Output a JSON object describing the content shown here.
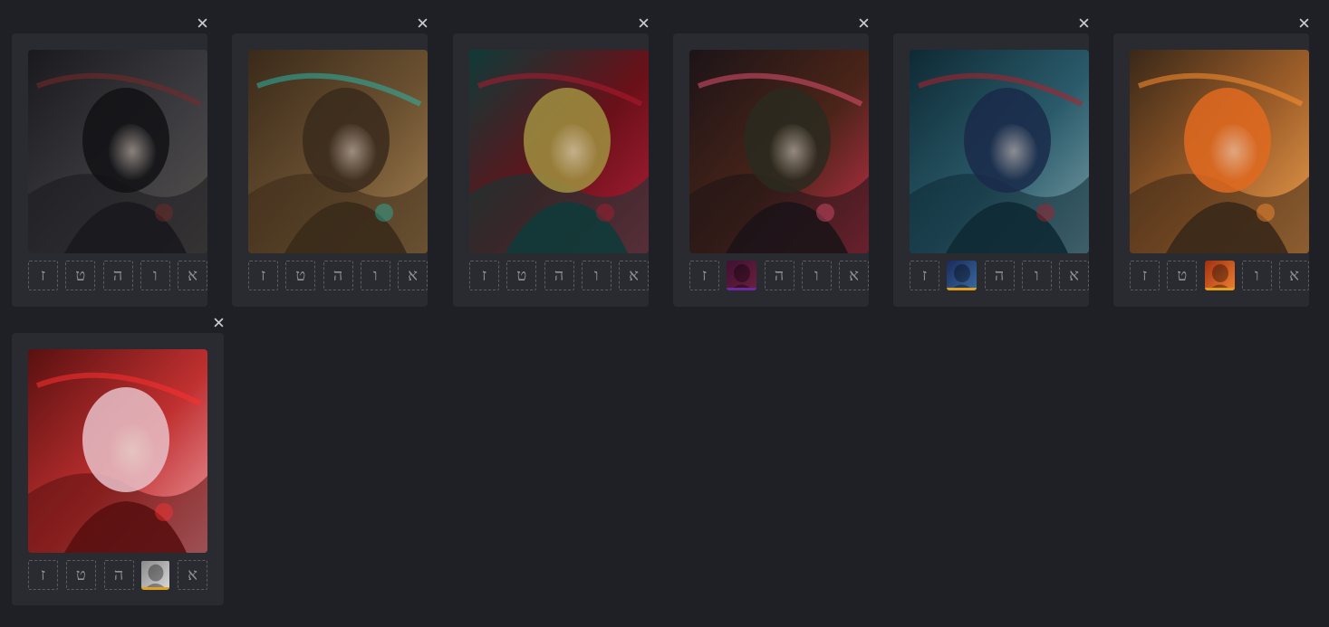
{
  "cards": [
    {
      "id": "card-1",
      "portrait": {
        "bg": [
          "#1a1a1e",
          "#3a3a3f",
          "#58524e"
        ],
        "accent": "#7a2a2a",
        "hair": "#121215"
      },
      "slots": [
        {
          "label": "ז",
          "filled": false
        },
        {
          "label": "ט",
          "filled": false
        },
        {
          "label": "ה",
          "filled": false
        },
        {
          "label": "ו",
          "filled": false
        },
        {
          "label": "א",
          "filled": false
        }
      ]
    },
    {
      "id": "card-2",
      "portrait": {
        "bg": [
          "#3a2a1a",
          "#6a5030",
          "#a48050"
        ],
        "accent": "#2bb3a5",
        "hair": "#3a2a1c"
      },
      "slots": [
        {
          "label": "ז",
          "filled": false
        },
        {
          "label": "ט",
          "filled": false
        },
        {
          "label": "ה",
          "filled": false
        },
        {
          "label": "ו",
          "filled": false
        },
        {
          "label": "א",
          "filled": false
        }
      ]
    },
    {
      "id": "card-3",
      "portrait": {
        "bg": [
          "#0f3a38",
          "#6a1018",
          "#b0203a"
        ],
        "accent": "#b01a30",
        "hair": "#a09040"
      },
      "slots": [
        {
          "label": "ז",
          "filled": false
        },
        {
          "label": "ט",
          "filled": false
        },
        {
          "label": "ה",
          "filled": false
        },
        {
          "label": "ו",
          "filled": false
        },
        {
          "label": "א",
          "filled": false
        }
      ]
    },
    {
      "id": "card-4",
      "portrait": {
        "bg": [
          "#1c1418",
          "#4a2418",
          "#c8304a"
        ],
        "accent": "#e05070",
        "hair": "#2a2a20"
      },
      "slots": [
        {
          "label": "ז",
          "filled": false
        },
        {
          "label": "",
          "filled": true,
          "thumb": [
            "#401030",
            "#6a2040"
          ],
          "rank_color": "#6a2aa0",
          "icon": "character-thumbnail-icon"
        },
        {
          "label": "ה",
          "filled": false
        },
        {
          "label": "ו",
          "filled": false
        },
        {
          "label": "א",
          "filled": false
        }
      ]
    },
    {
      "id": "card-5",
      "portrait": {
        "bg": [
          "#0e2a34",
          "#2a5a6a",
          "#7aa0a8"
        ],
        "accent": "#b0202a",
        "hair": "#1a2a4a"
      },
      "slots": [
        {
          "label": "ז",
          "filled": false
        },
        {
          "label": "",
          "filled": true,
          "thumb": [
            "#1a2a5a",
            "#3a6aa0"
          ],
          "rank_color": "#e0a020",
          "icon": "character-thumbnail-icon"
        },
        {
          "label": "ה",
          "filled": false
        },
        {
          "label": "ו",
          "filled": false
        },
        {
          "label": "א",
          "filled": false
        }
      ]
    },
    {
      "id": "card-6",
      "portrait": {
        "bg": [
          "#3a2818",
          "#a0602a",
          "#f0a050"
        ],
        "accent": "#ff9030",
        "hair": "#e06a20"
      },
      "slots": [
        {
          "label": "ז",
          "filled": false
        },
        {
          "label": "ט",
          "filled": false
        },
        {
          "label": "",
          "filled": true,
          "thumb": [
            "#a03010",
            "#f08030"
          ],
          "rank_color": "#e0a020",
          "icon": "character-thumbnail-icon"
        },
        {
          "label": "ו",
          "filled": false
        },
        {
          "label": "א",
          "filled": false
        }
      ]
    },
    {
      "id": "card-7",
      "portrait": {
        "bg": [
          "#5a1010",
          "#c03030",
          "#f0a0a8"
        ],
        "accent": "#ff3030",
        "hair": "#e8c0c8"
      },
      "slots": [
        {
          "label": "ז",
          "filled": false
        },
        {
          "label": "ט",
          "filled": false
        },
        {
          "label": "ה",
          "filled": false
        },
        {
          "label": "",
          "filled": true,
          "thumb": [
            "#8a8a8a",
            "#d8d8d8"
          ],
          "rank_color": "#e0a020",
          "icon": "character-thumbnail-icon"
        },
        {
          "label": "א",
          "filled": false
        }
      ]
    }
  ]
}
